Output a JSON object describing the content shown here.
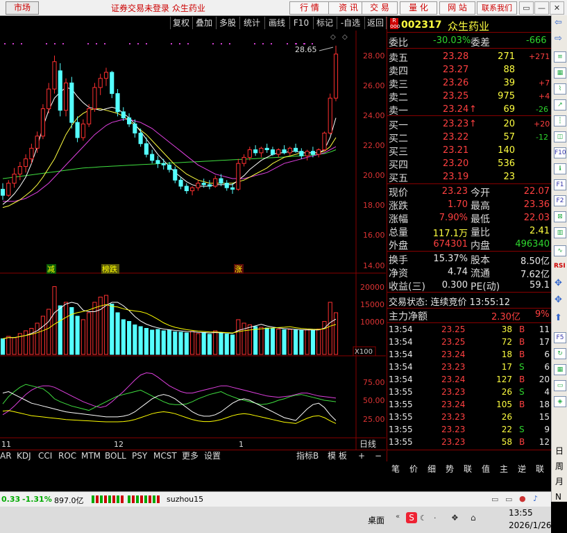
{
  "topbar": {
    "market": "市场",
    "title": "证券交易未登录  众生药业",
    "nav": [
      "行 情",
      "资 讯",
      "交 易",
      "量 化",
      "网 站",
      "联系我们"
    ],
    "win_min": "▭",
    "win_restore": "—",
    "win_max": "□",
    "win_close": "✕"
  },
  "toolbar": [
    "复权",
    "叠加",
    "多股",
    "统计",
    "画线",
    "F10",
    "标记",
    "-自选",
    "返回"
  ],
  "chart": {
    "peak_label": "28.65",
    "price_axis": [
      "28.00",
      "26.00",
      "24.00",
      "22.00",
      "20.00",
      "18.00",
      "16.00",
      "14.00"
    ],
    "vol_axis": [
      "20000",
      "15000",
      "10000"
    ],
    "vol_unit": "X100",
    "osc_axis": [
      "75.00",
      "50.00",
      "25.00"
    ],
    "x_labels": [
      "11",
      "12",
      "1"
    ],
    "day_label": "日线",
    "events": [
      "减",
      "榜跌",
      "涨"
    ],
    "colors": {
      "up": "#ff3030",
      "down": "#5ff",
      "ma5": "#ffffff",
      "ma10": "#ffff40",
      "ma20": "#e040e0",
      "ma60": "#40e040"
    }
  },
  "chart_data": {
    "type": "candlestick",
    "ylim": [
      13,
      30
    ],
    "candles": [
      {
        "o": 19.2,
        "h": 19.6,
        "l": 18.5,
        "c": 18.8
      },
      {
        "o": 18.8,
        "h": 19.8,
        "l": 18.7,
        "c": 19.6
      },
      {
        "o": 19.6,
        "h": 20.6,
        "l": 19.3,
        "c": 20.2
      },
      {
        "o": 20.2,
        "h": 21.0,
        "l": 19.8,
        "c": 20.7
      },
      {
        "o": 20.7,
        "h": 21.5,
        "l": 20.3,
        "c": 21.2
      },
      {
        "o": 21.2,
        "h": 22.2,
        "l": 20.9,
        "c": 21.9
      },
      {
        "o": 21.9,
        "h": 23.0,
        "l": 21.6,
        "c": 22.7
      },
      {
        "o": 22.7,
        "h": 24.8,
        "l": 22.5,
        "c": 24.5
      },
      {
        "o": 24.5,
        "h": 26.2,
        "l": 24.2,
        "c": 25.8
      },
      {
        "o": 25.8,
        "h": 28.0,
        "l": 25.5,
        "c": 27.6
      },
      {
        "o": 27.0,
        "h": 27.5,
        "l": 24.0,
        "c": 24.4
      },
      {
        "o": 24.4,
        "h": 26.5,
        "l": 24.0,
        "c": 26.2
      },
      {
        "o": 26.2,
        "h": 26.6,
        "l": 23.2,
        "c": 23.6
      },
      {
        "o": 23.6,
        "h": 24.0,
        "l": 22.3,
        "c": 22.6
      },
      {
        "o": 22.6,
        "h": 23.8,
        "l": 22.4,
        "c": 23.5
      },
      {
        "o": 23.5,
        "h": 24.8,
        "l": 23.3,
        "c": 24.5
      },
      {
        "o": 24.5,
        "h": 26.2,
        "l": 24.3,
        "c": 25.9
      },
      {
        "o": 25.9,
        "h": 26.8,
        "l": 25.4,
        "c": 26.5
      },
      {
        "o": 26.5,
        "h": 27.2,
        "l": 26.0,
        "c": 26.9
      },
      {
        "o": 26.9,
        "h": 27.0,
        "l": 25.2,
        "c": 25.5
      },
      {
        "o": 25.5,
        "h": 25.8,
        "l": 24.0,
        "c": 24.3
      },
      {
        "o": 24.3,
        "h": 24.6,
        "l": 23.7,
        "c": 23.9
      },
      {
        "o": 23.9,
        "h": 24.2,
        "l": 23.3,
        "c": 23.5
      },
      {
        "o": 23.5,
        "h": 23.8,
        "l": 22.6,
        "c": 22.9
      },
      {
        "o": 22.9,
        "h": 23.2,
        "l": 22.0,
        "c": 22.2
      },
      {
        "o": 22.2,
        "h": 22.6,
        "l": 21.3,
        "c": 21.5
      },
      {
        "o": 21.5,
        "h": 21.8,
        "l": 20.9,
        "c": 21.1
      },
      {
        "o": 21.1,
        "h": 21.4,
        "l": 20.6,
        "c": 20.9
      },
      {
        "o": 20.9,
        "h": 21.2,
        "l": 20.5,
        "c": 20.8
      },
      {
        "o": 20.8,
        "h": 21.0,
        "l": 20.3,
        "c": 20.5
      },
      {
        "o": 20.5,
        "h": 20.7,
        "l": 19.6,
        "c": 19.8
      },
      {
        "o": 19.8,
        "h": 20.0,
        "l": 19.2,
        "c": 19.4
      },
      {
        "o": 19.4,
        "h": 19.6,
        "l": 18.9,
        "c": 19.1
      },
      {
        "o": 19.1,
        "h": 19.4,
        "l": 18.8,
        "c": 19.3
      },
      {
        "o": 19.3,
        "h": 19.8,
        "l": 19.1,
        "c": 19.6
      },
      {
        "o": 19.6,
        "h": 19.9,
        "l": 19.3,
        "c": 19.5
      },
      {
        "o": 19.5,
        "h": 19.8,
        "l": 19.2,
        "c": 19.4
      },
      {
        "o": 19.4,
        "h": 20.1,
        "l": 19.3,
        "c": 19.9
      },
      {
        "o": 19.9,
        "h": 20.2,
        "l": 19.4,
        "c": 19.6
      },
      {
        "o": 19.6,
        "h": 19.8,
        "l": 19.1,
        "c": 19.3
      },
      {
        "o": 19.3,
        "h": 19.6,
        "l": 18.9,
        "c": 19.2
      },
      {
        "o": 19.2,
        "h": 21.2,
        "l": 19.1,
        "c": 20.9
      },
      {
        "o": 20.9,
        "h": 21.5,
        "l": 20.7,
        "c": 21.3
      },
      {
        "o": 21.3,
        "h": 22.0,
        "l": 21.1,
        "c": 21.8
      },
      {
        "o": 21.8,
        "h": 22.1,
        "l": 21.4,
        "c": 21.6
      },
      {
        "o": 21.6,
        "h": 22.0,
        "l": 21.3,
        "c": 21.9
      },
      {
        "o": 21.9,
        "h": 22.2,
        "l": 21.6,
        "c": 21.8
      },
      {
        "o": 21.8,
        "h": 22.0,
        "l": 21.4,
        "c": 21.5
      },
      {
        "o": 21.5,
        "h": 21.9,
        "l": 21.3,
        "c": 21.8
      },
      {
        "o": 21.8,
        "h": 22.1,
        "l": 21.5,
        "c": 21.6
      },
      {
        "o": 21.6,
        "h": 22.0,
        "l": 21.4,
        "c": 21.9
      },
      {
        "o": 21.9,
        "h": 22.2,
        "l": 21.6,
        "c": 21.7
      },
      {
        "o": 21.7,
        "h": 21.9,
        "l": 21.2,
        "c": 21.4
      },
      {
        "o": 21.4,
        "h": 21.8,
        "l": 21.1,
        "c": 21.7
      },
      {
        "o": 21.7,
        "h": 22.0,
        "l": 21.3,
        "c": 21.5
      },
      {
        "o": 21.5,
        "h": 21.9,
        "l": 21.3,
        "c": 21.8
      },
      {
        "o": 21.8,
        "h": 23.0,
        "l": 21.7,
        "c": 22.9
      },
      {
        "o": 22.9,
        "h": 25.5,
        "l": 22.8,
        "c": 25.2
      },
      {
        "o": 25.2,
        "h": 28.65,
        "l": 25.0,
        "c": 28.1
      }
    ],
    "volume": [
      4500,
      5200,
      4800,
      6000,
      6800,
      7500,
      9000,
      11000,
      13000,
      19500,
      14000,
      15000,
      13500,
      11000,
      10000,
      12000,
      15000,
      16500,
      17000,
      14500,
      12000,
      10000,
      9500,
      8500,
      8000,
      7500,
      7000,
      7200,
      6800,
      7000,
      6500,
      6400,
      6200,
      6600,
      6000,
      6300,
      5800,
      6800,
      6200,
      5900,
      5600,
      10000,
      9000,
      8500,
      8000,
      7800,
      7600,
      7400,
      7300,
      7100,
      7200,
      7000,
      6900,
      7100,
      7000,
      7300,
      9500,
      15000,
      12000
    ],
    "ma5": [
      18.2,
      18.5,
      18.9,
      19.4,
      20.0,
      20.9,
      22.0,
      23.3,
      24.4,
      25.2,
      25.6,
      25.9,
      25.8,
      25.3,
      24.9,
      24.6,
      24.5,
      24.4,
      24.5,
      24.6,
      24.5,
      24.2,
      23.9,
      23.5,
      23.0,
      22.5,
      22.0,
      21.5,
      21.1,
      20.7,
      20.3,
      20.0,
      19.7,
      19.5,
      19.4,
      19.4,
      19.4,
      19.5,
      19.5,
      19.5,
      19.5,
      19.8,
      20.1,
      20.5,
      20.8,
      21.1,
      21.3,
      21.5,
      21.6,
      21.6,
      21.7,
      21.7,
      21.6,
      21.6,
      21.6,
      21.6,
      21.8,
      22.6,
      23.9
    ],
    "ma10": [
      18.0,
      18.1,
      18.3,
      18.5,
      18.8,
      19.1,
      19.5,
      20.0,
      20.6,
      21.2,
      22.0,
      22.8,
      23.4,
      23.9,
      24.2,
      24.4,
      24.5,
      24.5,
      24.4,
      24.3,
      24.2,
      24.0,
      23.7,
      23.4,
      23.1,
      22.8,
      22.4,
      22.0,
      21.6,
      21.2,
      20.8,
      20.5,
      20.2,
      20.0,
      19.8,
      19.7,
      19.6,
      19.6,
      19.6,
      19.6,
      19.6,
      19.7,
      19.8,
      20.0,
      20.2,
      20.4,
      20.6,
      20.9,
      21.1,
      21.3,
      21.4,
      21.5,
      21.6,
      21.6,
      21.6,
      21.6,
      21.7,
      22.0,
      22.6
    ],
    "ma20": [
      18.4,
      18.4,
      18.4,
      18.5,
      18.6,
      18.8,
      19.0,
      19.3,
      19.6,
      20.0,
      20.4,
      20.8,
      21.2,
      21.6,
      22.0,
      22.4,
      22.8,
      23.1,
      23.4,
      23.6,
      23.7,
      23.8,
      23.8,
      23.7,
      23.6,
      23.4,
      23.2,
      22.9,
      22.6,
      22.3,
      22.0,
      21.7,
      21.4,
      21.1,
      20.8,
      20.6,
      20.4,
      20.2,
      20.1,
      20.0,
      19.9,
      19.9,
      19.9,
      20.0,
      20.1,
      20.2,
      20.3,
      20.5,
      20.7,
      20.9,
      21.0,
      21.1,
      21.2,
      21.3,
      21.4,
      21.5,
      21.6,
      21.8,
      22.0
    ],
    "ma60": [
      19.9,
      19.95,
      20.0,
      20.05,
      20.1,
      20.15,
      20.2,
      20.25,
      20.3,
      20.35,
      20.4,
      20.45,
      20.5,
      20.55,
      20.6,
      20.62,
      20.65,
      20.68,
      20.7,
      20.72,
      20.74,
      20.76,
      20.78,
      20.8,
      20.82,
      20.84,
      20.86,
      20.88,
      20.9,
      20.92,
      20.94,
      20.96,
      20.98,
      21.0,
      21.02,
      21.04,
      21.06,
      21.08,
      21.1,
      21.12,
      21.14,
      21.16,
      21.18,
      21.2,
      21.22,
      21.24,
      21.26,
      21.28,
      21.3,
      21.32,
      21.35,
      21.38,
      21.4,
      21.43,
      21.46,
      21.5,
      21.55,
      21.65,
      21.8
    ],
    "kdj_k": [
      45,
      55,
      62,
      68,
      72,
      70,
      68,
      66,
      60,
      52,
      48,
      45,
      42,
      40,
      38,
      36,
      40,
      44,
      48,
      52,
      56,
      58,
      60,
      62,
      64,
      60,
      56,
      52,
      48,
      45,
      44,
      44,
      45,
      48,
      52,
      55,
      58,
      60,
      62,
      58,
      55,
      52,
      50,
      48,
      46,
      44,
      45,
      47,
      50,
      52,
      55,
      57,
      58,
      56,
      54,
      52,
      50,
      49,
      48
    ],
    "kdj_d": [
      30,
      35,
      42,
      50,
      58,
      64,
      68,
      70,
      70,
      68,
      64,
      60,
      56,
      52,
      48,
      45,
      42,
      40,
      42,
      48,
      55,
      62,
      70,
      78,
      85,
      88,
      87,
      82,
      76,
      70,
      66,
      62,
      60,
      60,
      62,
      64,
      66,
      68,
      70,
      70,
      68,
      66,
      64,
      62,
      60,
      58,
      56,
      55,
      54,
      55,
      56,
      58,
      60,
      60,
      58,
      56,
      55,
      54,
      53
    ],
    "kdj_j": [
      60,
      62,
      58,
      54,
      50,
      46,
      44,
      42,
      40,
      38,
      36,
      34,
      33,
      32,
      31,
      30,
      29,
      28,
      27,
      27,
      27,
      28,
      30,
      34,
      40,
      46,
      52,
      56,
      58,
      56,
      52,
      46,
      40,
      34,
      30,
      28,
      28,
      30,
      34,
      40,
      46,
      50,
      52,
      50,
      46,
      42,
      38,
      34,
      30,
      26,
      24,
      22,
      30,
      38,
      44,
      46,
      40,
      30,
      22
    ]
  },
  "quote": {
    "code": "002317",
    "name": "众生药业",
    "wb_label": "委比",
    "wb_value": "-30.03%",
    "wc_label": "委差",
    "wc_value": "-666",
    "sell": [
      {
        "label": "卖五",
        "price": "23.28",
        "vol": "271",
        "chg": "+271"
      },
      {
        "label": "卖四",
        "price": "23.27",
        "vol": "88",
        "chg": ""
      },
      {
        "label": "卖三",
        "price": "23.26",
        "vol": "39",
        "chg": "+7"
      },
      {
        "label": "卖二",
        "price": "23.25",
        "vol": "975",
        "chg": "+4"
      },
      {
        "label": "卖一",
        "price": "23.24",
        "vol": "69",
        "chg": "-26",
        "arrow": "↑"
      }
    ],
    "buy": [
      {
        "label": "买一",
        "price": "23.23",
        "vol": "20",
        "chg": "+20",
        "arrow": "↑"
      },
      {
        "label": "买二",
        "price": "23.22",
        "vol": "57",
        "chg": "-12"
      },
      {
        "label": "买三",
        "price": "23.21",
        "vol": "140",
        "chg": ""
      },
      {
        "label": "买四",
        "price": "23.20",
        "vol": "536",
        "chg": ""
      },
      {
        "label": "买五",
        "price": "23.19",
        "vol": "23",
        "chg": ""
      }
    ],
    "stats": [
      {
        "l1": "现价",
        "v1": "23.23",
        "l2": "今开",
        "v2": "22.07"
      },
      {
        "l1": "涨跌",
        "v1": "1.70",
        "l2": "最高",
        "v2": "23.36"
      },
      {
        "l1": "涨幅",
        "v1": "7.90%",
        "l2": "最低",
        "v2": "22.03"
      },
      {
        "l1": "总量",
        "v1": "117.1万",
        "l2": "量比",
        "v2": "2.41"
      },
      {
        "l1": "外盘",
        "v1": "674301",
        "l2": "内盘",
        "v2": "496340"
      }
    ],
    "stats2": [
      {
        "l1": "换手",
        "v1": "15.37%",
        "l2": "股本",
        "v2": "8.50亿"
      },
      {
        "l1": "净资",
        "v1": "4.74",
        "l2": "流通",
        "v2": "7.62亿"
      },
      {
        "l1": "收益(三)",
        "v1": "0.300",
        "l2": "PE(动)",
        "v2": "59.1"
      }
    ],
    "trade_status": "交易状态: 连续竞价 13:55:12",
    "main_flow_label": "主力净额",
    "main_flow_value": "2.30亿",
    "main_flow_pct": "9%",
    "ticks": [
      {
        "t": "13:54",
        "p": "23.25",
        "v": "38",
        "s": "B",
        "n": "11"
      },
      {
        "t": "13:54",
        "p": "23.25",
        "v": "72",
        "s": "B",
        "n": "17"
      },
      {
        "t": "13:54",
        "p": "23.24",
        "v": "18",
        "s": "B",
        "n": "6"
      },
      {
        "t": "13:54",
        "p": "23.23",
        "v": "17",
        "s": "S",
        "n": "6"
      },
      {
        "t": "13:54",
        "p": "23.24",
        "v": "127",
        "s": "B",
        "n": "20"
      },
      {
        "t": "13:55",
        "p": "23.23",
        "v": "26",
        "s": "S",
        "n": "4"
      },
      {
        "t": "13:55",
        "p": "23.24",
        "v": "105",
        "s": "B",
        "n": "18"
      },
      {
        "t": "13:55",
        "p": "23.23",
        "v": "26",
        "s": "",
        "n": "15"
      },
      {
        "t": "13:55",
        "p": "23.23",
        "v": "22",
        "s": "S",
        "n": "9"
      },
      {
        "t": "13:55",
        "p": "23.23",
        "v": "58",
        "s": "B",
        "n": "12"
      }
    ],
    "bottom_tabs": [
      "笔",
      "价",
      "细",
      "势",
      "联",
      "值",
      "主",
      "逆",
      "联"
    ]
  },
  "bottom_tabs": [
    "AR",
    "KDJ",
    "CCI",
    "ROC",
    "MTM",
    "BOLL",
    "PSY",
    "MCST",
    "更多",
    "设置"
  ],
  "bottom_tabs_right": [
    "指标B",
    "模 板",
    "+",
    "−"
  ],
  "status": {
    "v1": "0.33",
    "v2": "-1.31%",
    "v3": "897.0亿",
    "user": "suzhou15"
  },
  "taskbar": {
    "desktop": "桌面",
    "time": "13:55",
    "date": "2026/1/26"
  },
  "sidebar": [
    "日",
    "周",
    "月",
    "N"
  ]
}
